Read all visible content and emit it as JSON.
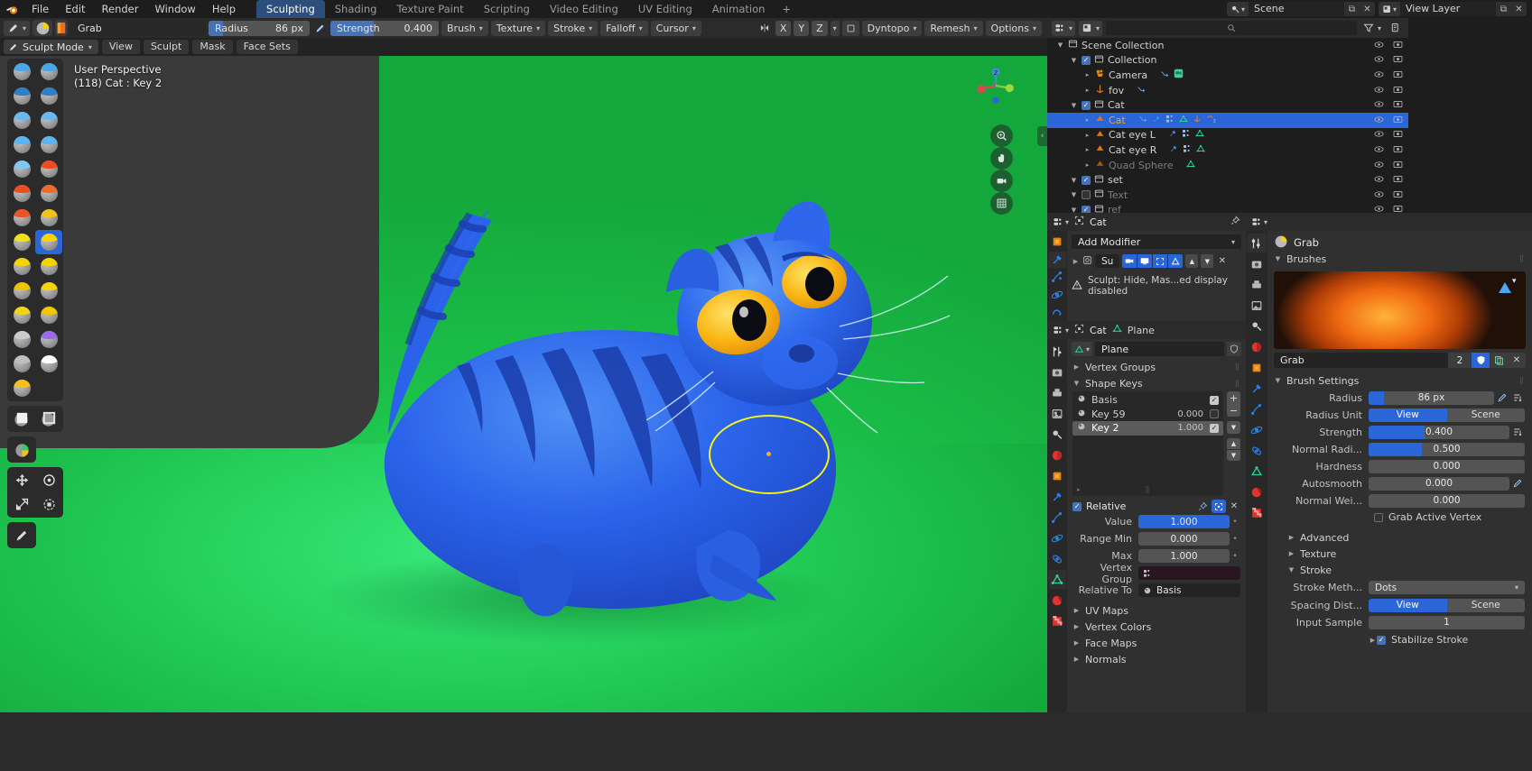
{
  "app": {
    "title": "Blender",
    "logo_icon": "blender-logo"
  },
  "topbar": {
    "menus": [
      "File",
      "Edit",
      "Render",
      "Window",
      "Help"
    ],
    "workspace_tabs": [
      {
        "label": "Sculpting",
        "active": true
      },
      {
        "label": "Shading",
        "active": false
      },
      {
        "label": "Texture Paint",
        "active": false
      },
      {
        "label": "Scripting",
        "active": false
      },
      {
        "label": "Video Editing",
        "active": false
      },
      {
        "label": "UV Editing",
        "active": false
      },
      {
        "label": "Animation",
        "active": false
      }
    ],
    "add_tab_label": "+",
    "scene": {
      "label": "Scene",
      "icon": "scene-icon",
      "new_icon": "copy-icon",
      "unlink_icon": "x-icon"
    },
    "view_layer": {
      "label": "View Layer",
      "icon": "view-layer-icon",
      "new_icon": "copy-icon",
      "unlink_icon": "x-icon"
    }
  },
  "viewport_header": {
    "tool_icon": "brush-tool-icon",
    "brush_preview_icon": "brush-preview-icon",
    "texture_preview_icon": "texture-preview-icon",
    "brush_name": "Grab",
    "radius": {
      "label": "Radius",
      "value": "86 px",
      "fill_pct": 14,
      "pressure_icon": "pressure-icon"
    },
    "strength": {
      "label": "Strength",
      "value": "0.400",
      "fill_pct": 40
    },
    "dropdowns": [
      "Brush",
      "Texture",
      "Stroke",
      "Falloff",
      "Cursor"
    ],
    "symmetry_icon": "symmetry-icon",
    "axis_buttons": [
      "X",
      "Y",
      "Z"
    ],
    "mirror_icon": "mirror-object-icon",
    "right_dropdowns": [
      "Dyntopo",
      "Remesh",
      "Options"
    ],
    "overlay_icons": [
      "visibility-icon",
      "gizmo-icon",
      "overlays-icon",
      "xray-icon"
    ],
    "shading_modes": [
      "wireframe-shading-icon",
      "solid-shading-icon",
      "material-shading-icon",
      "rendered-shading-icon"
    ],
    "shading_active_index": 2
  },
  "tool_header": {
    "mode": "Sculpt Mode",
    "mode_icon": "sculpt-mode-icon",
    "menus": [
      "View",
      "Sculpt",
      "Mask",
      "Face Sets"
    ]
  },
  "viewport": {
    "overlay": {
      "line1": "User Perspective",
      "line2": "(118) Cat : Key 2"
    },
    "toolbar": [
      {
        "name": "draw-brush-tool",
        "cap": "#4aa8e8",
        "selected": false
      },
      {
        "name": "draw-sharp-brush-tool",
        "cap": "#4aa8e8",
        "selected": false
      },
      {
        "name": "clay-brush-tool",
        "cap": "#2f7ec9",
        "selected": false
      },
      {
        "name": "clay-strips-brush-tool",
        "cap": "#2f7ec9",
        "selected": false
      },
      {
        "name": "clay-thumb-brush-tool",
        "cap": "#6bb8ef",
        "selected": false
      },
      {
        "name": "layer-brush-tool",
        "cap": "#6bb8ef",
        "selected": false
      },
      {
        "name": "inflate-brush-tool",
        "cap": "#5ab4f0",
        "selected": false
      },
      {
        "name": "blob-brush-tool",
        "cap": "#5ab4f0",
        "selected": false
      },
      {
        "name": "crease-brush-tool",
        "cap": "#7fc6f5",
        "selected": false
      },
      {
        "name": "smooth-brush-tool",
        "cap": "#ef4b20",
        "selected": false
      },
      {
        "name": "flatten-brush-tool",
        "cap": "#ef4b20",
        "selected": false
      },
      {
        "name": "fill-brush-tool",
        "cap": "#ef6a2a",
        "selected": false
      },
      {
        "name": "scrape-brush-tool",
        "cap": "#e8552a",
        "selected": false
      },
      {
        "name": "multiplane-scrape-tool",
        "cap": "#f2c21a",
        "selected": false
      },
      {
        "name": "pinch-brush-tool",
        "cap": "#f2e01a",
        "selected": false
      },
      {
        "name": "grab-brush-tool",
        "cap": "#f5d400",
        "selected": true
      },
      {
        "name": "elastic-deform-tool",
        "cap": "#f5d400",
        "selected": false
      },
      {
        "name": "snake-hook-tool",
        "cap": "#f5d400",
        "selected": false
      },
      {
        "name": "thumb-brush-tool",
        "cap": "#f0c400",
        "selected": false
      },
      {
        "name": "pose-brush-tool",
        "cap": "#f5d400",
        "selected": false
      },
      {
        "name": "nudge-brush-tool",
        "cap": "#f2d21a",
        "selected": false
      },
      {
        "name": "rotate-brush-tool",
        "cap": "#f5c400",
        "selected": false
      },
      {
        "name": "slide-relax-tool",
        "cap": "#cccccc",
        "selected": false
      },
      {
        "name": "cloth-brush-tool",
        "cap": "#9b6ae8",
        "selected": false
      },
      {
        "name": "simplify-brush-tool",
        "cap": "#bfbfbf",
        "selected": false
      },
      {
        "name": "mask-brush-tool",
        "cap": "#ffffff",
        "selected": false
      },
      {
        "name": "paint-brush-tool",
        "cap": "#f2c21a",
        "selected": false
      }
    ],
    "toolbar_extra": [
      {
        "name": "box-mask-tool"
      },
      {
        "name": "box-hide-tool"
      },
      {
        "name": "box-face-set-tool"
      },
      {
        "name": "move-tool"
      },
      {
        "name": "rotate-tool"
      },
      {
        "name": "scale-tool"
      },
      {
        "name": "transform-tool"
      },
      {
        "name": "annotate-tool"
      }
    ],
    "nav_buttons": [
      "zoom-icon",
      "pan-icon",
      "camera-icon",
      "ortho-grid-icon"
    ],
    "gizmo_axes": [
      "X",
      "Y",
      "Z"
    ],
    "brush_cursor": {
      "radius_px": 86,
      "color": "#f2f21c"
    },
    "subject": "blue cat sculpt on green background"
  },
  "outliner": {
    "display_mode_icon": "editor-type-icon",
    "filter_icon": "filter-icon",
    "display_filter_icon": "display-filter-icon",
    "search_placeholder": "",
    "search_icon": "search-icon",
    "rows": [
      {
        "name": "Scene Collection",
        "icon": "collection-icon",
        "depth": 0,
        "checkbox": null,
        "selected": false,
        "dim": false,
        "badges": []
      },
      {
        "name": "Collection",
        "icon": "collection-icon",
        "depth": 1,
        "checkbox": true,
        "selected": false,
        "dim": false,
        "badges": []
      },
      {
        "name": "Camera",
        "icon": "camera-data-icon",
        "depth": 2,
        "checkbox": null,
        "selected": false,
        "dim": false,
        "badges": [
          "animation-icon",
          "camera-object-icon"
        ]
      },
      {
        "name": "fov",
        "icon": "empty-icon",
        "depth": 2,
        "checkbox": null,
        "selected": false,
        "dim": false,
        "badges": [
          "animation-icon"
        ]
      },
      {
        "name": "Cat",
        "icon": "collection-icon",
        "depth": 1,
        "checkbox": true,
        "selected": false,
        "dim": false,
        "badges": []
      },
      {
        "name": "Cat",
        "icon": "mesh-object-icon",
        "depth": 2,
        "checkbox": null,
        "selected": true,
        "dim": false,
        "badges": [
          "animation-icon",
          "modifier-icon",
          "vertex-group-icon",
          "mesh-data-icon",
          "shapekey-icon",
          "shapekey-count-icon"
        ]
      },
      {
        "name": "Cat eye L",
        "icon": "mesh-object-icon",
        "depth": 2,
        "checkbox": null,
        "selected": false,
        "dim": false,
        "badges": [
          "modifier-icon",
          "vertex-group-icon",
          "mesh-data-icon"
        ]
      },
      {
        "name": "Cat eye R",
        "icon": "mesh-object-icon",
        "depth": 2,
        "checkbox": null,
        "selected": false,
        "dim": false,
        "badges": [
          "modifier-icon",
          "vertex-group-icon",
          "mesh-data-icon"
        ]
      },
      {
        "name": "Quad Sphere",
        "icon": "mesh-object-icon",
        "depth": 2,
        "checkbox": null,
        "selected": false,
        "dim": true,
        "badges": [
          "mesh-data-icon"
        ]
      },
      {
        "name": "set",
        "icon": "collection-icon",
        "depth": 1,
        "checkbox": true,
        "selected": false,
        "dim": false,
        "badges": [
          "mesh-object-icon"
        ]
      },
      {
        "name": "Text",
        "icon": "collection-icon",
        "depth": 1,
        "checkbox": false,
        "selected": false,
        "dim": true,
        "badges": []
      },
      {
        "name": "ref",
        "icon": "collection-icon",
        "depth": 1,
        "checkbox": true,
        "selected": false,
        "dim": true,
        "badges": [
          "mesh-object-icon"
        ]
      }
    ],
    "col_icons": [
      "hide-icon",
      "disable-render-icon"
    ]
  },
  "modifier_properties": {
    "breadcrumb_icon": "editor-type-icon",
    "object_icon": "object-icon",
    "object_name": "Cat",
    "pin_icon": "pin-icon",
    "tabs": [
      "object-tab",
      "modifier-tab",
      "particles-tab",
      "physics-tab",
      "constraints-tab"
    ],
    "add_modifier_label": "Add Modifier",
    "modifier": {
      "expand_icon": "expand-triangle-icon",
      "type_icon": "subsurf-icon",
      "name": "Su",
      "toggles": [
        "render-visibility-icon",
        "realtime-visibility-icon",
        "edit-mode-icon",
        "on-cage-icon"
      ],
      "move_up_icon": "up-arrow-icon",
      "move_down_icon": "down-arrow-icon",
      "delete_icon": "x-icon"
    },
    "warning": {
      "icon": "warning-icon",
      "text": "Sculpt: Hide, Mas...ed display disabled"
    }
  },
  "object_data_properties": {
    "breadcrumb_icon": "editor-type-icon",
    "object_icon": "object-icon",
    "object_name": "Cat",
    "data_icon": "mesh-data-icon",
    "mesh_data_icon": "mesh-data-icon",
    "mesh_name": "Plane",
    "shield_icon": "fake-user-icon",
    "sections": [
      {
        "label": "Vertex Groups",
        "open": false
      },
      {
        "label": "Shape Keys",
        "open": true
      }
    ],
    "shape_keys": {
      "items": [
        {
          "name": "Basis",
          "value": "",
          "mute": true,
          "active": false
        },
        {
          "name": "Key 59",
          "value": "0.000",
          "mute": false,
          "active": false
        },
        {
          "name": "Key 2",
          "value": "1.000",
          "mute": true,
          "active": true
        }
      ],
      "side_buttons": [
        "add-shapekey-icon",
        "remove-shapekey-icon",
        "specials-menu-icon",
        "move-up-icon",
        "move-down-icon"
      ],
      "relative_label": "Relative",
      "relative_checked": true,
      "pin_icon": "pin-icon",
      "edit_mode_icon": "shapekey-edit-mode-icon",
      "clear_icon": "x-icon",
      "fields": [
        {
          "label": "Value",
          "value": "1.000",
          "fill_pct": 100,
          "accent": true
        },
        {
          "label": "Range Min",
          "value": "0.000",
          "fill_pct": 0,
          "accent": false
        },
        {
          "label": "Max",
          "value": "1.000",
          "fill_pct": 0,
          "accent": false
        }
      ],
      "vertex_group": {
        "label": "Vertex Group",
        "value": "",
        "icon": "vertex-group-icon"
      },
      "relative_to": {
        "label": "Relative To",
        "value": "Basis",
        "icon": "shapekey-icon"
      }
    },
    "closed_sections": [
      "UV Maps",
      "Vertex Colors",
      "Face Maps",
      "Normals"
    ],
    "tabs": [
      "tool-tab",
      "render-tab",
      "output-tab",
      "view-layer-tab",
      "scene-tab",
      "world-tab",
      "object-tab",
      "modifier-tab",
      "particles-tab",
      "physics-tab",
      "constraints-tab",
      "data-tab",
      "material-tab",
      "texture-tab"
    ]
  },
  "brush_properties": {
    "breadcrumb_icon": "editor-type-icon",
    "tool_tab_icon": "tool-tab-icon",
    "brush_icon": "grab-brush-icon",
    "brush_header_name": "Grab",
    "brushes_section": "Brushes",
    "brush_datablock": {
      "name": "Grab",
      "users": "2",
      "shield_icon": "fake-user-icon",
      "copy_icon": "new-copy-icon",
      "unlink_icon": "x-icon"
    },
    "brush_settings_section": "Brush Settings",
    "settings": [
      {
        "label": "Radius",
        "value": "86 px",
        "fill_pct": 12,
        "accent": true,
        "extras": [
          "pressure-icon",
          "input-settings-icon"
        ]
      },
      {
        "label": "Radius Unit",
        "toggle": [
          "View",
          "Scene"
        ],
        "active": 0
      },
      {
        "label": "Strength",
        "value": "0.400",
        "fill_pct": 40,
        "accent": true,
        "extras": [
          "input-settings-icon"
        ]
      },
      {
        "label": "Normal Radi...",
        "value": "0.500",
        "fill_pct": 34,
        "accent": true,
        "extras": []
      },
      {
        "label": "Hardness",
        "value": "0.000",
        "fill_pct": 0,
        "accent": false,
        "extras": []
      },
      {
        "label": "Autosmooth",
        "value": "0.000",
        "fill_pct": 0,
        "accent": false,
        "extras": [
          "pressure-icon"
        ]
      },
      {
        "label": "Normal Wei...",
        "value": "0.000",
        "fill_pct": 0,
        "accent": false,
        "extras": []
      }
    ],
    "grab_active_vertex": {
      "label": "Grab Active Vertex",
      "checked": false
    },
    "sub_sections": [
      {
        "label": "Advanced",
        "open": false
      },
      {
        "label": "Texture",
        "open": false
      },
      {
        "label": "Stroke",
        "open": true
      }
    ],
    "stroke": {
      "method": {
        "label": "Stroke Meth...",
        "value": "Dots"
      },
      "spacing_dist": {
        "label": "Spacing Dist...",
        "toggle": [
          "View",
          "Scene"
        ],
        "active": 0
      },
      "input_samples": {
        "label": "Input Sample",
        "value": "1"
      },
      "stabilize": {
        "label": "Stabilize Stroke",
        "checked": true
      }
    }
  }
}
